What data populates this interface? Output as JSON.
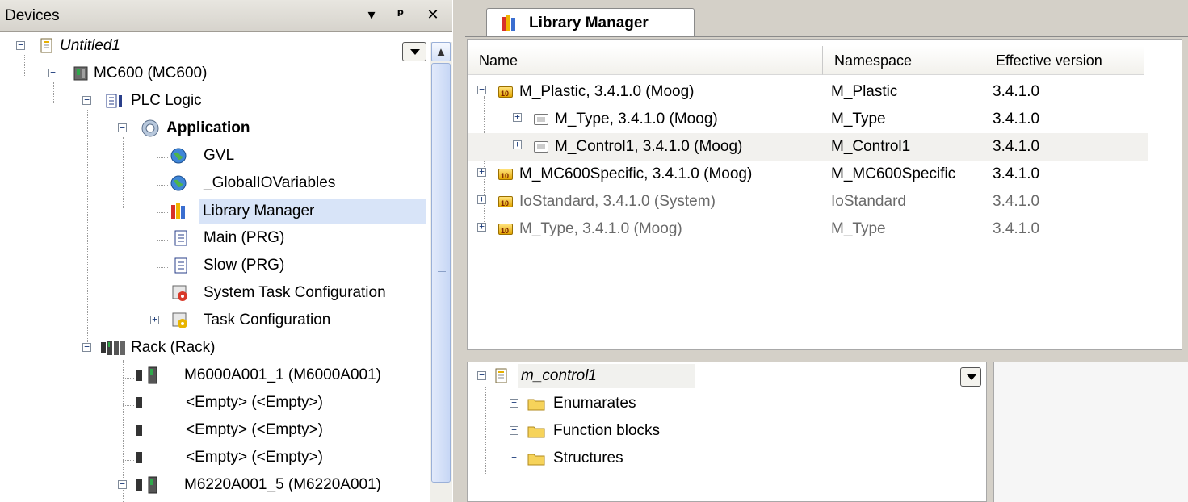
{
  "devices": {
    "title": "Devices",
    "header_buttons": {
      "dropdown": "▾",
      "pin": "ᵖ",
      "close": "✕"
    },
    "tree": [
      {
        "label": "Untitled1",
        "icon": "project-icon",
        "expander": "−",
        "italic": true
      },
      {
        "label": "MC600 (MC600)",
        "icon": "controller-icon",
        "expander": "−"
      },
      {
        "label": "PLC Logic",
        "icon": "plc-logic-icon",
        "expander": "−"
      },
      {
        "label": "Application",
        "icon": "application-gear-icon",
        "expander": "−",
        "bold": true
      },
      {
        "label": "GVL",
        "icon": "globe-icon"
      },
      {
        "label": "_GlobalIOVariables",
        "icon": "globe-icon"
      },
      {
        "label": "Library Manager",
        "icon": "library-books-icon",
        "selected": true
      },
      {
        "label": "Main (PRG)",
        "icon": "document-icon"
      },
      {
        "label": "Slow (PRG)",
        "icon": "document-icon"
      },
      {
        "label": "System Task Configuration",
        "icon": "task-config-icon"
      },
      {
        "label": "Task Configuration",
        "icon": "task-config-icon",
        "expander": "+"
      },
      {
        "label": "Rack (Rack)",
        "icon": "rack-icon",
        "expander": "−"
      },
      {
        "label": "M6000A001_1 (M6000A001)",
        "icon": "module-icon"
      },
      {
        "label": "<Empty> (<Empty>)",
        "icon": "empty-slot-icon"
      },
      {
        "label": "<Empty> (<Empty>)",
        "icon": "empty-slot-icon"
      },
      {
        "label": "<Empty> (<Empty>)",
        "icon": "empty-slot-icon"
      },
      {
        "label": "M6220A001_5 (M6220A001)",
        "icon": "module-icon",
        "expander": "−"
      }
    ]
  },
  "library_manager": {
    "tab_title": "Library Manager",
    "columns": [
      "Name",
      "Namespace",
      "Effective version"
    ],
    "rows": [
      {
        "name": "M_Plastic, 3.4.1.0 (Moog)",
        "namespace": "M_Plastic",
        "version": "3.4.1.0",
        "expander": "−",
        "icon": "library-gold-icon"
      },
      {
        "name": "M_Type, 3.4.1.0 (Moog)",
        "namespace": "M_Type",
        "version": "3.4.1.0",
        "expander": "+",
        "icon": "library-gray-icon",
        "child": true
      },
      {
        "name": "M_Control1, 3.4.1.0 (Moog)",
        "namespace": "M_Control1",
        "version": "3.4.1.0",
        "expander": "+",
        "icon": "library-gray-icon",
        "child": true,
        "selected": true
      },
      {
        "name": "M_MC600Specific, 3.4.1.0 (Moog)",
        "namespace": "M_MC600Specific",
        "version": "3.4.1.0",
        "expander": "+",
        "icon": "library-gold-icon"
      },
      {
        "name": "IoStandard, 3.4.1.0 (System)",
        "namespace": "IoStandard",
        "version": "3.4.1.0",
        "expander": "+",
        "icon": "library-gold-icon",
        "dim": true
      },
      {
        "name": "M_Type, 3.4.1.0 (Moog)",
        "namespace": "M_Type",
        "version": "3.4.1.0",
        "expander": "+",
        "icon": "library-gold-icon",
        "dim": true
      }
    ],
    "lib_tree": {
      "root": "m_control1",
      "items": [
        "Enumarates",
        "Function blocks",
        "Structures"
      ]
    }
  }
}
